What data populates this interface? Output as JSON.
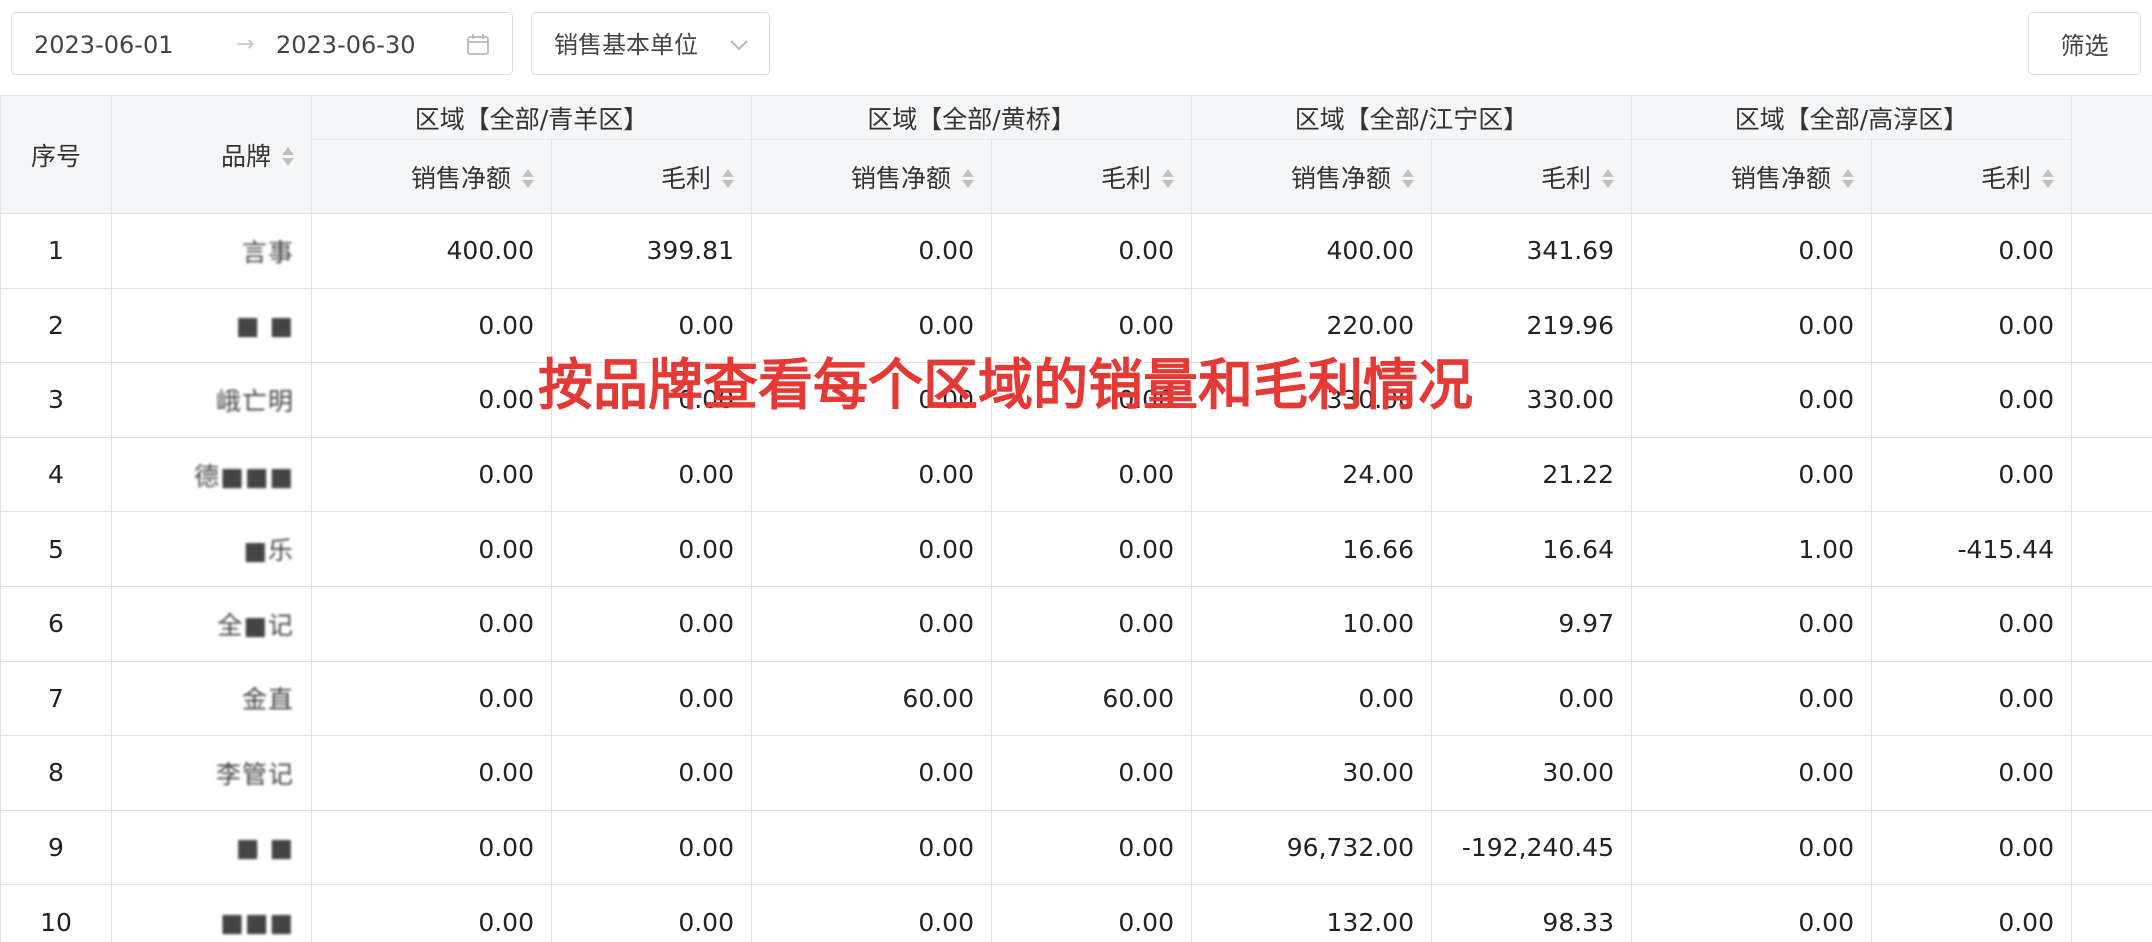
{
  "toolbar": {
    "date_start": "2023-06-01",
    "date_end": "2023-06-30",
    "range_separator": "→",
    "unit_select_value": "销售基本单位",
    "filter_label": "筛选"
  },
  "table": {
    "index_header": "序号",
    "brand_header": "品牌",
    "regions": [
      {
        "label": "区域【全部/青羊区】",
        "sales_label": "销售净额",
        "profit_label": "毛利"
      },
      {
        "label": "区域【全部/黄桥】",
        "sales_label": "销售净额",
        "profit_label": "毛利"
      },
      {
        "label": "区域【全部/江宁区】",
        "sales_label": "销售净额",
        "profit_label": "毛利"
      },
      {
        "label": "区域【全部/高淳区】",
        "sales_label": "销售净额",
        "profit_label": "毛利"
      }
    ],
    "rows": [
      {
        "index": "1",
        "brand": "言事",
        "cells": [
          "400.00",
          "399.81",
          "0.00",
          "0.00",
          "400.00",
          "341.69",
          "0.00",
          "0.00"
        ]
      },
      {
        "index": "2",
        "brand": "■ ■",
        "cells": [
          "0.00",
          "0.00",
          "0.00",
          "0.00",
          "220.00",
          "219.96",
          "0.00",
          "0.00"
        ]
      },
      {
        "index": "3",
        "brand": "峨亡明",
        "cells": [
          "0.00",
          "0.00",
          "0.00",
          "0.00",
          "330.00",
          "330.00",
          "0.00",
          "0.00"
        ]
      },
      {
        "index": "4",
        "brand": "德■■■",
        "cells": [
          "0.00",
          "0.00",
          "0.00",
          "0.00",
          "24.00",
          "21.22",
          "0.00",
          "0.00"
        ]
      },
      {
        "index": "5",
        "brand": "■乐",
        "cells": [
          "0.00",
          "0.00",
          "0.00",
          "0.00",
          "16.66",
          "16.64",
          "1.00",
          "-415.44"
        ]
      },
      {
        "index": "6",
        "brand": "全■记",
        "cells": [
          "0.00",
          "0.00",
          "0.00",
          "0.00",
          "10.00",
          "9.97",
          "0.00",
          "0.00"
        ]
      },
      {
        "index": "7",
        "brand": "金直",
        "cells": [
          "0.00",
          "0.00",
          "60.00",
          "60.00",
          "0.00",
          "0.00",
          "0.00",
          "0.00"
        ]
      },
      {
        "index": "8",
        "brand": "李管记",
        "cells": [
          "0.00",
          "0.00",
          "0.00",
          "0.00",
          "30.00",
          "30.00",
          "0.00",
          "0.00"
        ]
      },
      {
        "index": "9",
        "brand": "■ ■",
        "cells": [
          "0.00",
          "0.00",
          "0.00",
          "0.00",
          "96,732.00",
          "-192,240.45",
          "0.00",
          "0.00"
        ]
      },
      {
        "index": "10",
        "brand": "■■■",
        "cells": [
          "0.00",
          "0.00",
          "0.00",
          "0.00",
          "132.00",
          "98.33",
          "0.00",
          "0.00"
        ]
      }
    ]
  },
  "overlay_caption": "按品牌查看每个区域的销量和毛利情况",
  "colors": {
    "caption": "#e53935",
    "header_bg": "#f5f6f7",
    "border": "#e2e2e2"
  }
}
